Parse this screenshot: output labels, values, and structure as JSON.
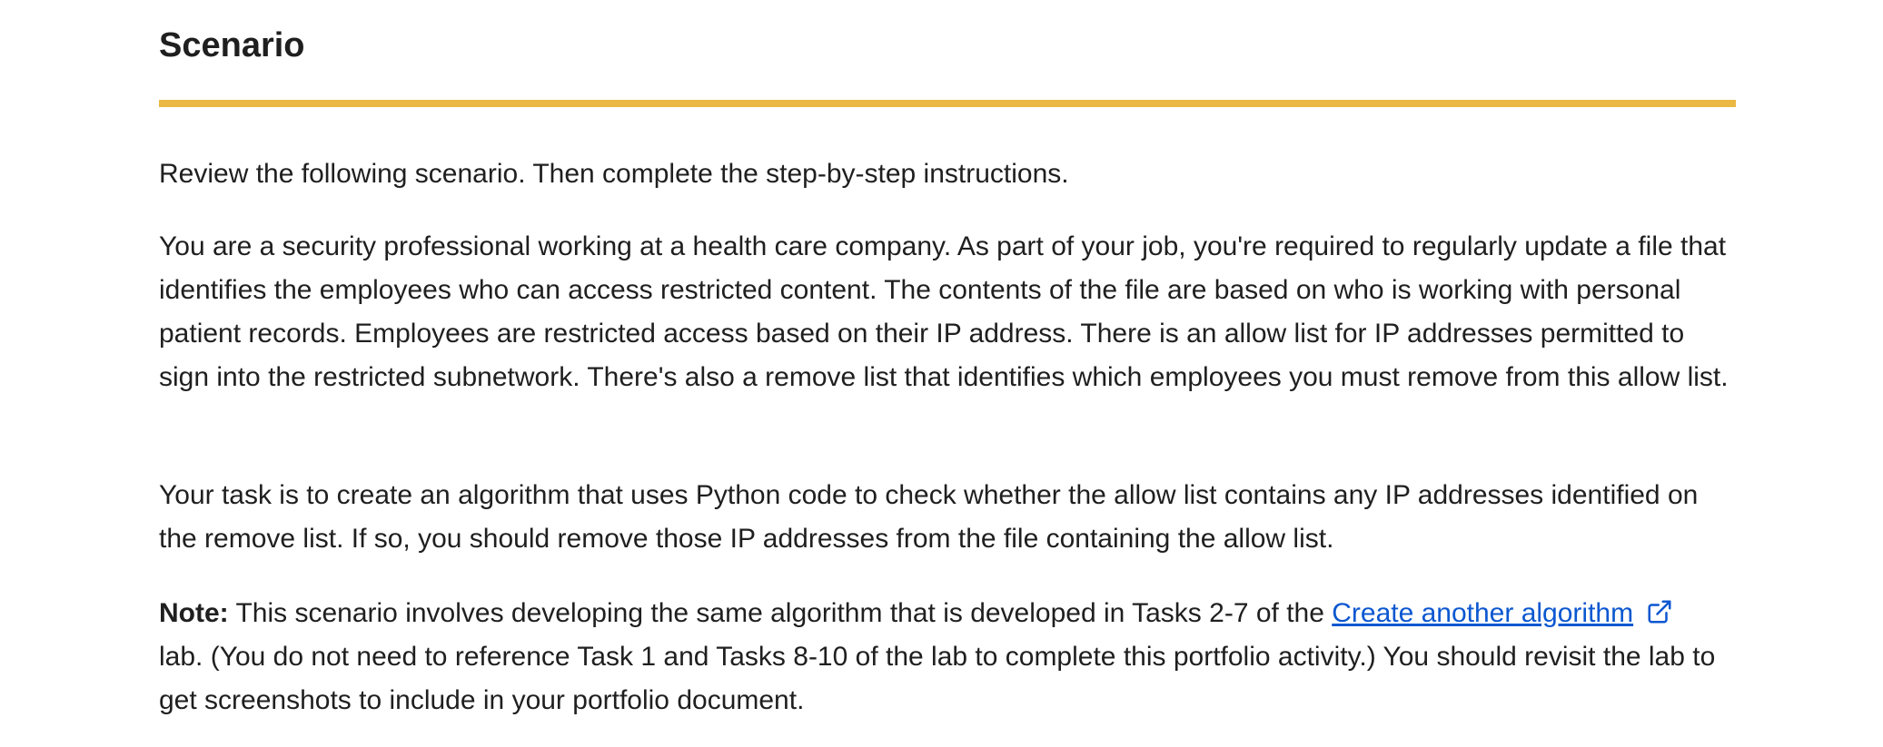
{
  "section": {
    "title": "Scenario"
  },
  "paragraphs": {
    "intro": "Review the following scenario. Then complete the step-by-step instructions.",
    "context": "You are a security professional working at a health care company. As part of your job, you're required to regularly update a file that identifies the employees who can access restricted content. The contents of the file are based on who is working with personal patient records. Employees are restricted access based on their IP address. There is an allow list for IP addresses permitted to sign into the restricted subnetwork. There's also a remove list that identifies which employees you must remove from this allow list.",
    "task": "Your task is to create an algorithm that uses Python code to check whether the allow list contains any IP addresses identified on the remove list. If so, you should remove those IP addresses from the file containing the allow list."
  },
  "note": {
    "label": "Note:",
    "text_before": " This scenario involves developing the same algorithm that is developed in Tasks 2-7 of the ",
    "link_text": "Create another algorithm",
    "link_icon": "external-link-icon",
    "text_after": "lab. (You do not need to reference Task 1 and Tasks 8-10 of the lab to complete this portfolio activity.) You should revisit the lab to get screenshots to include in your portfolio document."
  },
  "colors": {
    "accent_divider": "#eab843",
    "link": "#0b57d0",
    "text": "#1f1f1f"
  }
}
